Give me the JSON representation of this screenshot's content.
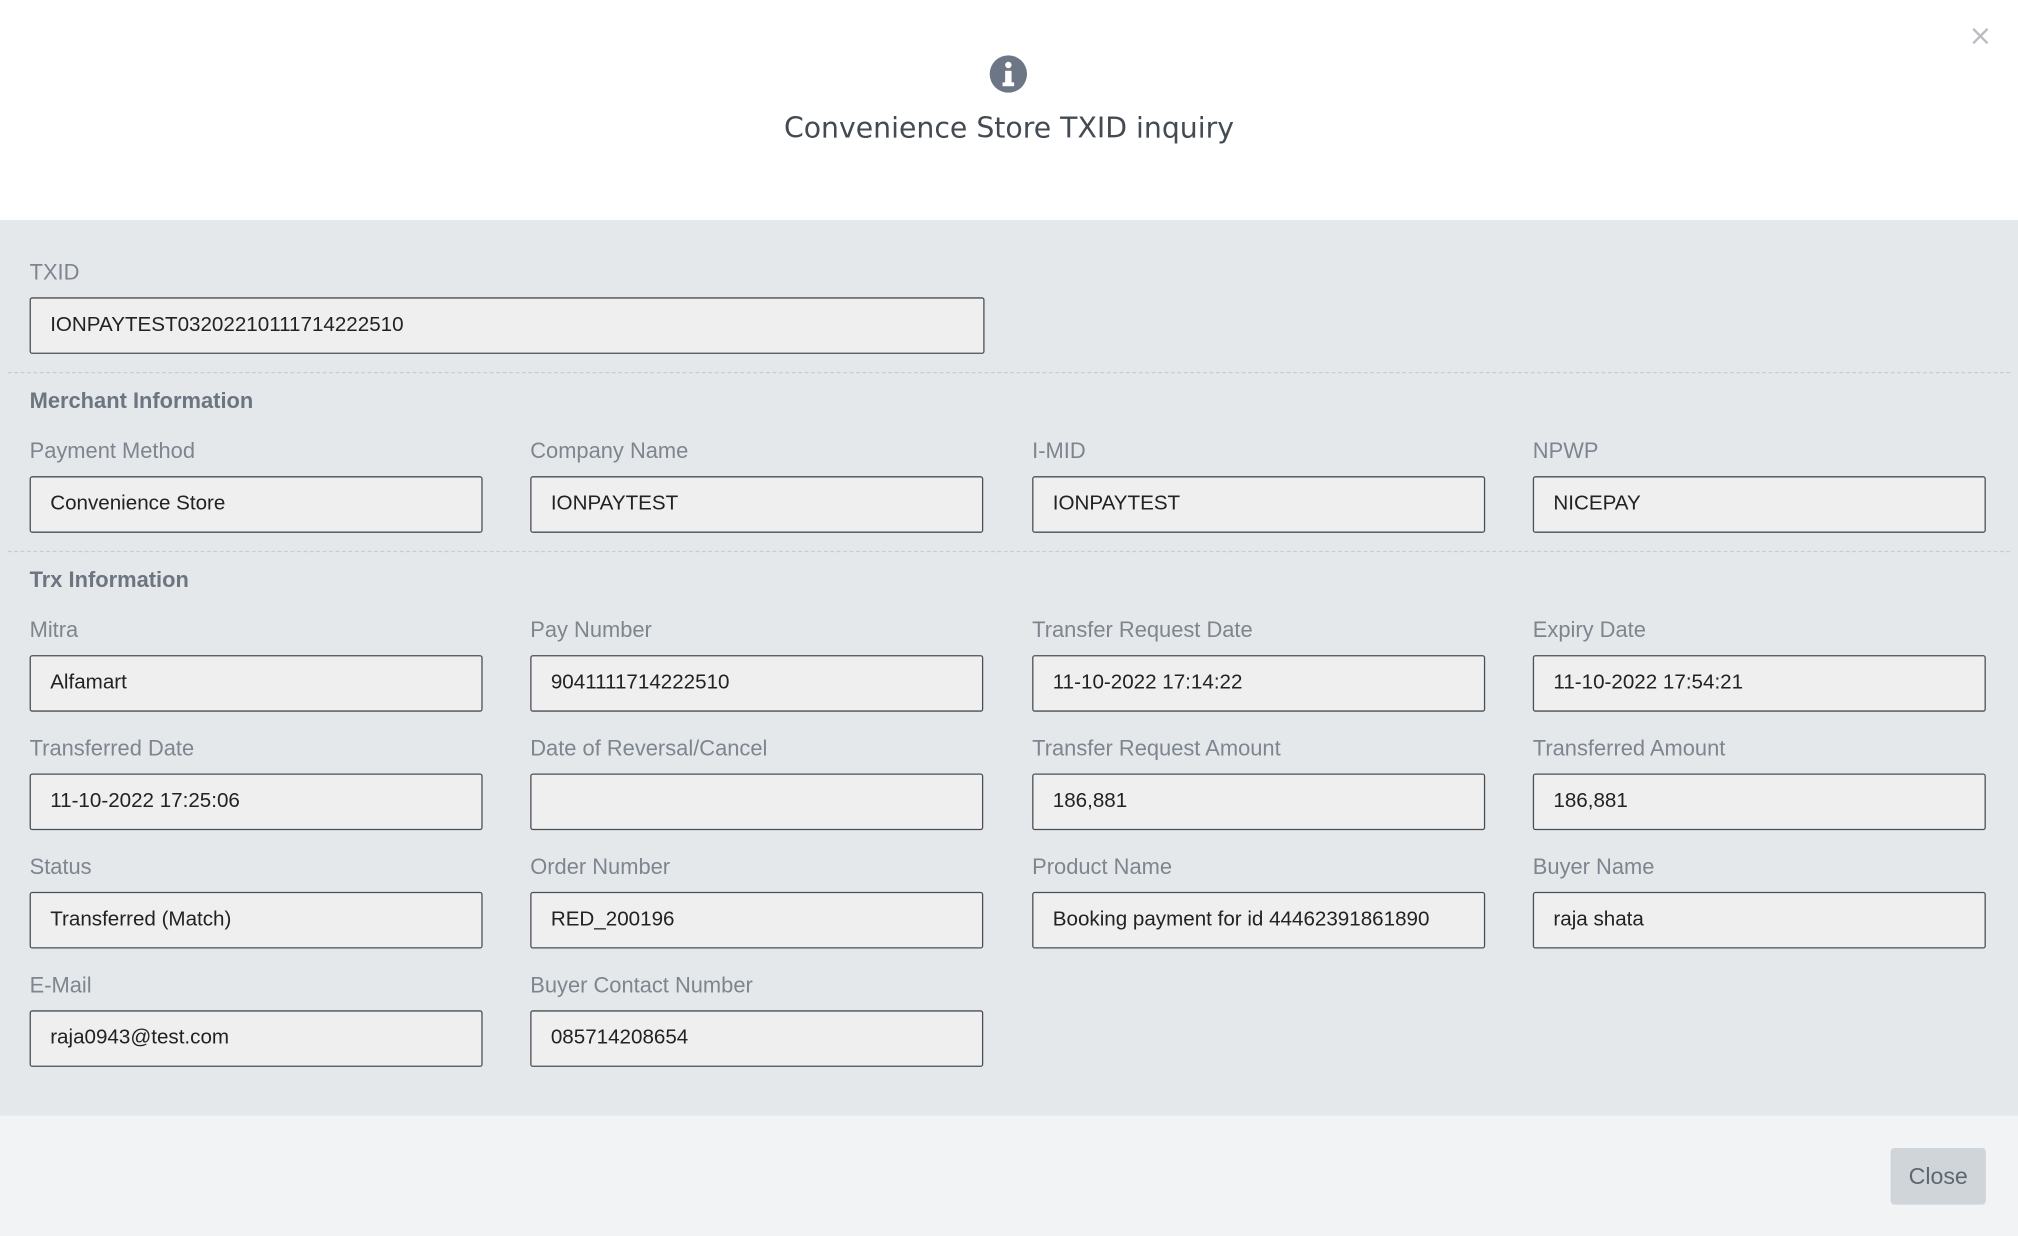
{
  "dialog": {
    "title": "Convenience Store TXID inquiry",
    "header_icon": "info-icon",
    "close_icon": "close-icon",
    "close_glyph": "×"
  },
  "txid": {
    "label": "TXID",
    "value": "IONPAYTEST03202210111714222510"
  },
  "merchant": {
    "heading": "Merchant Information",
    "fields": [
      {
        "label": "Payment Method",
        "value": "Convenience Store"
      },
      {
        "label": "Company Name",
        "value": "IONPAYTEST"
      },
      {
        "label": "I-MID",
        "value": "IONPAYTEST"
      },
      {
        "label": "NPWP",
        "value": "NICEPAY"
      }
    ]
  },
  "trx": {
    "heading": "Trx Information",
    "fields": [
      {
        "label": "Mitra",
        "value": "Alfamart"
      },
      {
        "label": "Pay Number",
        "value": "9041111714222510"
      },
      {
        "label": "Transfer Request Date",
        "value": "11-10-2022 17:14:22"
      },
      {
        "label": "Expiry Date",
        "value": "11-10-2022 17:54:21"
      },
      {
        "label": "Transferred Date",
        "value": "11-10-2022 17:25:06"
      },
      {
        "label": "Date of Reversal/Cancel",
        "value": ""
      },
      {
        "label": "Transfer Request Amount",
        "value": "186,881"
      },
      {
        "label": "Transferred Amount",
        "value": "186,881"
      },
      {
        "label": "Status",
        "value": "Transferred (Match)"
      },
      {
        "label": "Order Number",
        "value": "RED_200196"
      },
      {
        "label": "Product Name",
        "value": "Booking payment for id 44462391861890"
      },
      {
        "label": "Buyer Name",
        "value": "raja shata"
      },
      {
        "label": "E-Mail",
        "value": "raja0943@test.com"
      },
      {
        "label": "Buyer Contact Number",
        "value": "085714208654"
      }
    ]
  },
  "footer": {
    "close_label": "Close"
  }
}
